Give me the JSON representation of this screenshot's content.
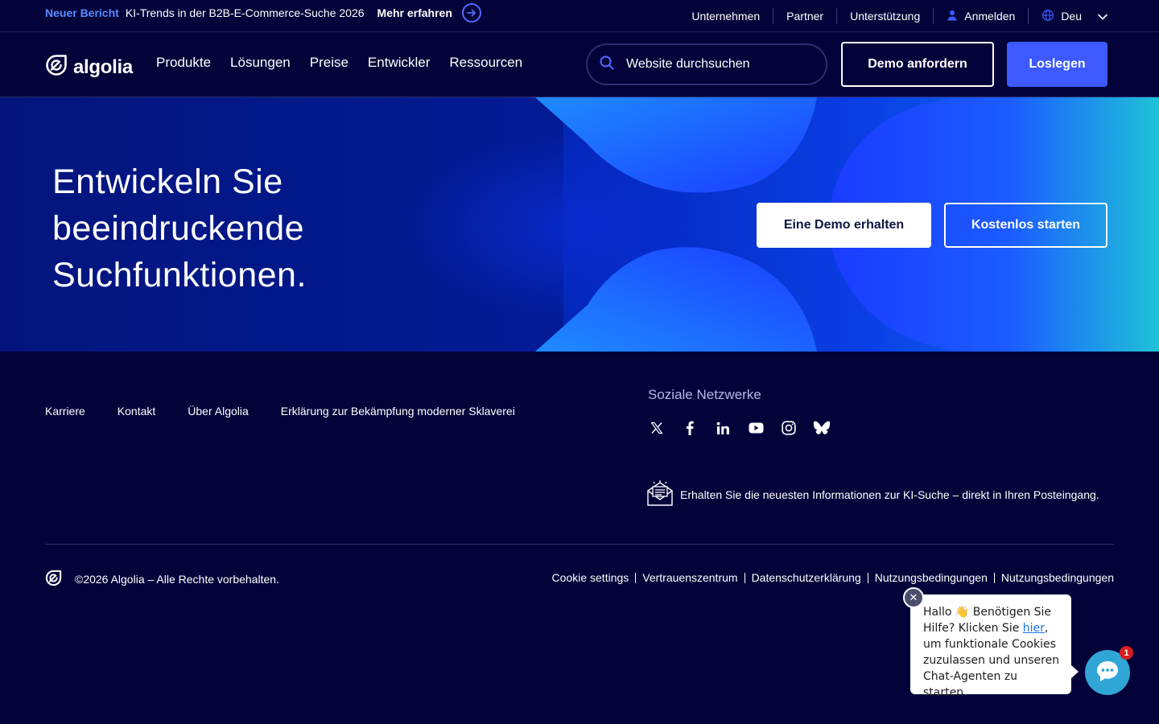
{
  "announcement": {
    "tag": "Neuer Bericht",
    "text": "KI-Trends in der B2B-E-Commerce-Suche 2026",
    "cta": "Mehr erfahren"
  },
  "utility_nav": {
    "company": "Unternehmen",
    "partners": "Partner",
    "support": "Unterstützung",
    "login": "Anmelden",
    "language": "Deu"
  },
  "header": {
    "logo_text": "algolia",
    "nav": [
      "Produkte",
      "Lösungen",
      "Preise",
      "Entwickler",
      "Ressourcen"
    ],
    "search_placeholder": "Website durchsuchen",
    "demo_button": "Demo anfordern",
    "start_button": "Loslegen"
  },
  "hero": {
    "title_lines": [
      "Entwickeln Sie",
      "beeindruckende",
      "Suchfunktionen."
    ],
    "demo_button": "Eine Demo erhalten",
    "free_button": "Kostenlos starten"
  },
  "footer": {
    "links": [
      "Karriere",
      "Kontakt",
      "Über Algolia",
      "Erklärung zur Bekämpfung moderner Sklaverei"
    ],
    "social_title": "Soziale Netzwerke",
    "social_icons": [
      "x-icon",
      "facebook-icon",
      "linkedin-icon",
      "youtube-icon",
      "instagram-icon",
      "bluesky-icon"
    ],
    "newsletter_text": "Erhalten Sie die neuesten Informationen zur KI-Suche – direkt in Ihren Posteingang.",
    "copyright": "©2026 Algolia – Alle Rechte vorbehalten.",
    "legal": [
      "Cookie settings",
      "Vertrauenszentrum",
      "Datenschutzerklärung",
      "Nutzungsbedingungen",
      "Nutzungsbedingungen"
    ]
  },
  "chat": {
    "message_before_link": "Hallo 👋 Benötigen Sie Hilfe? Klicken Sie ",
    "link_text": "hier",
    "message_after_link": ", um funktionale Cookies zuzulassen und unseren Chat-Agenten zu starten.",
    "badge_count": "1",
    "close_symbol": "✕"
  },
  "colors": {
    "page_bg": "#03033a",
    "accent": "#3c5aff",
    "hero_bg": "#031a8a",
    "chat": "#30a6d6",
    "badge": "#d91d1d"
  }
}
